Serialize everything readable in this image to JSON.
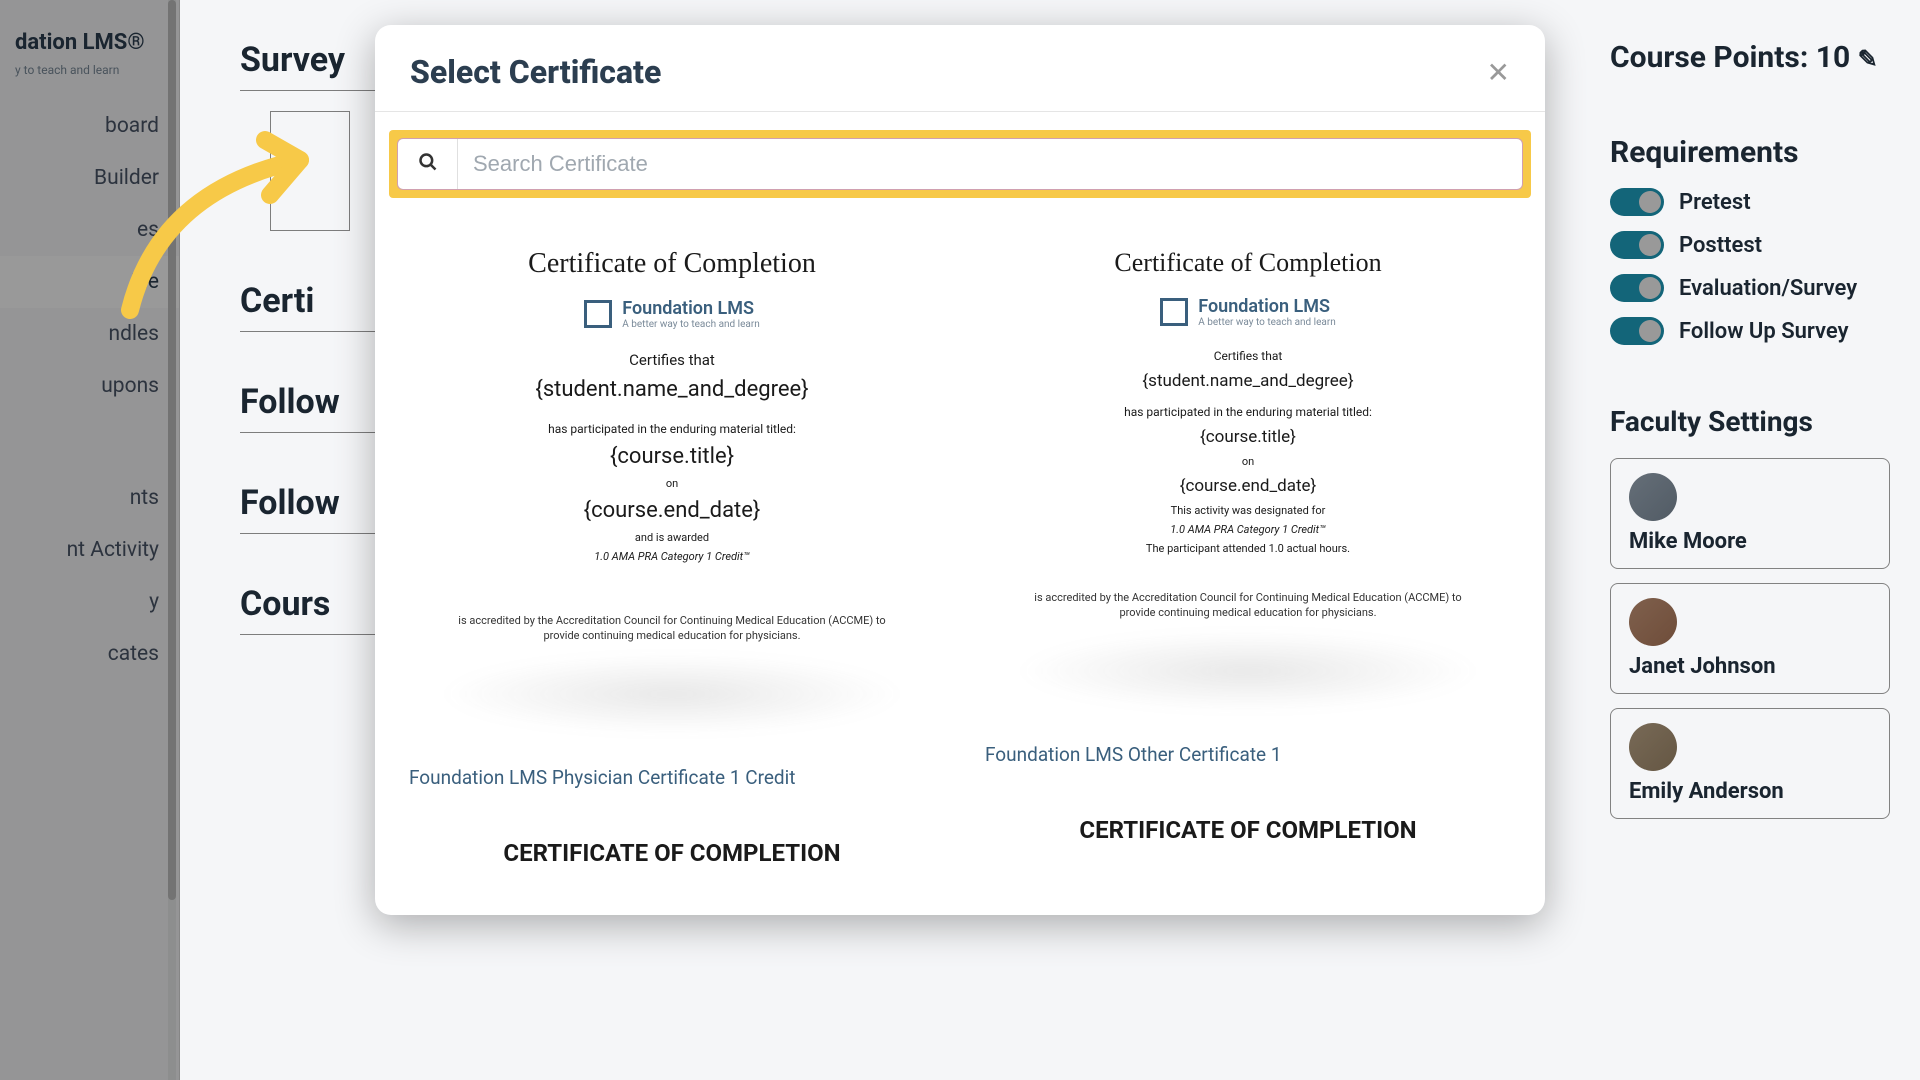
{
  "brand": {
    "name_suffix": "dation LMS®",
    "tagline_suffix": "y to teach and learn"
  },
  "sidebar": {
    "items": [
      "board",
      "Builder",
      "es",
      "ine",
      "ndles",
      "upons",
      "nts",
      "nt Activity",
      "y",
      "cates"
    ],
    "active_index": 3
  },
  "sections": {
    "survey": "Survey",
    "certificates": "Certi",
    "followup1": "Follow",
    "followup2": "Follow",
    "course": "Cours"
  },
  "right_panel": {
    "course_points_label": "Course Points:",
    "course_points_value": "10",
    "requirements_heading": "Requirements",
    "requirements": [
      "Pretest",
      "Posttest",
      "Evaluation/Survey",
      "Follow Up Survey"
    ],
    "faculty_heading": "Faculty Settings",
    "faculty": [
      "Mike Moore",
      "Janet Johnson",
      "Emily Anderson"
    ]
  },
  "modal": {
    "title": "Select Certificate",
    "search_placeholder": "Search Certificate",
    "certificates": [
      {
        "heading": "Certificate of Completion",
        "logo_name": "Foundation LMS",
        "logo_sub": "A better way to teach and learn",
        "certifies": "Certifies that",
        "student_var": "{student.name_and_degree}",
        "participated": "has participated in the enduring material titled:",
        "course_var": "{course.title}",
        "on": "on",
        "end_date_var": "{course.end_date}",
        "awarded": "and is awarded",
        "credit": "1.0 AMA PRA Category 1 Credit™",
        "accred": "is accredited by the Accreditation Council for Continuing Medical Education (ACCME) to provide continuing medical education for physicians.",
        "name": "Foundation LMS Physician Certificate 1 Credit"
      },
      {
        "heading": "Certificate of Completion",
        "logo_name": "Foundation LMS",
        "logo_sub": "A better way to teach and learn",
        "certifies": "Certifies that",
        "student_var": "{student.name_and_degree}",
        "participated": "has participated in the enduring material titled:",
        "course_var": "{course.title}",
        "on": "on",
        "end_date_var": "{course.end_date}",
        "designated": "This activity was designated for",
        "credit": "1.0 AMA PRA Category 1 Credit™",
        "actual_hours": "The participant attended 1.0 actual hours.",
        "accred": "is accredited by the Accreditation Council for Continuing Medical Education (ACCME) to provide continuing medical education for physicians.",
        "name": "Foundation LMS Other Certificate 1"
      }
    ],
    "next_heading": "CERTIFICATE OF COMPLETION"
  }
}
